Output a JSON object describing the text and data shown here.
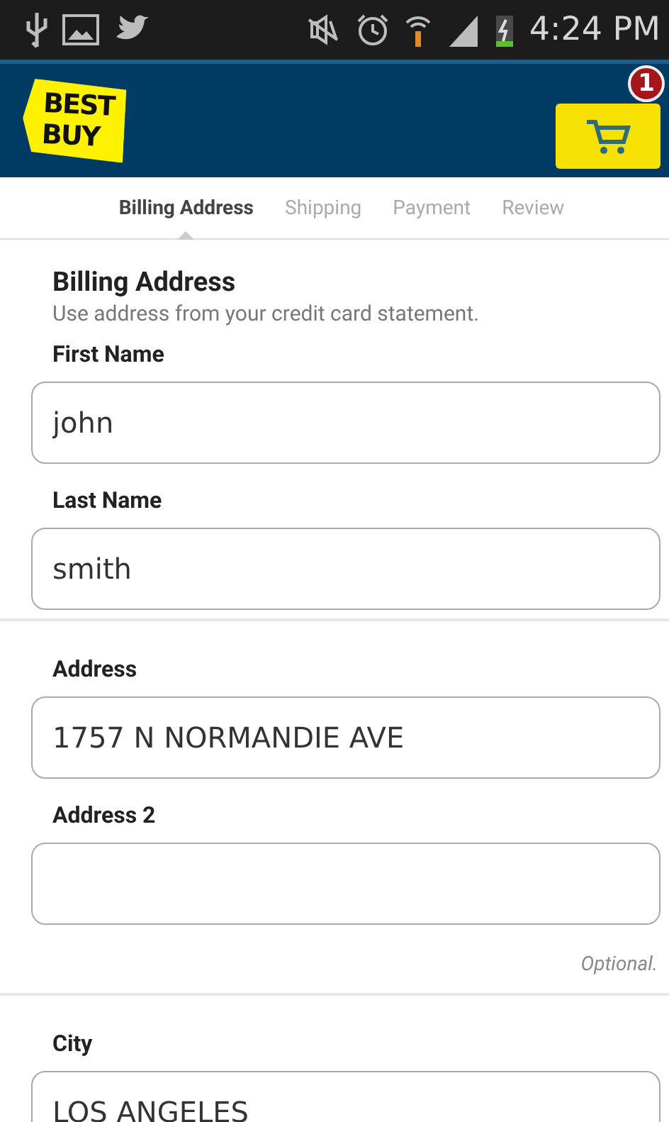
{
  "status_bar": {
    "time": "4:24 PM"
  },
  "header": {
    "logo_lines": [
      "BEST",
      "BUY"
    ],
    "cart_count": "1"
  },
  "steps": [
    {
      "label": "Billing Address",
      "selected": true
    },
    {
      "label": "Shipping",
      "selected": false
    },
    {
      "label": "Payment",
      "selected": false
    },
    {
      "label": "Review",
      "selected": false
    }
  ],
  "sections": [
    {
      "title": "Billing Address",
      "subtitle": "Use address from your credit card statement.",
      "fields": [
        {
          "label": "First Name",
          "value": "john"
        },
        {
          "label": "Last Name",
          "value": "smith"
        }
      ]
    },
    {
      "fields": [
        {
          "label": "Address",
          "value": "1757 N NORMANDIE AVE"
        },
        {
          "label": "Address 2",
          "hint": "Optional."
        }
      ]
    },
    {
      "fields": [
        {
          "label": "City",
          "value": "LOS ANGELES"
        }
      ]
    }
  ]
}
